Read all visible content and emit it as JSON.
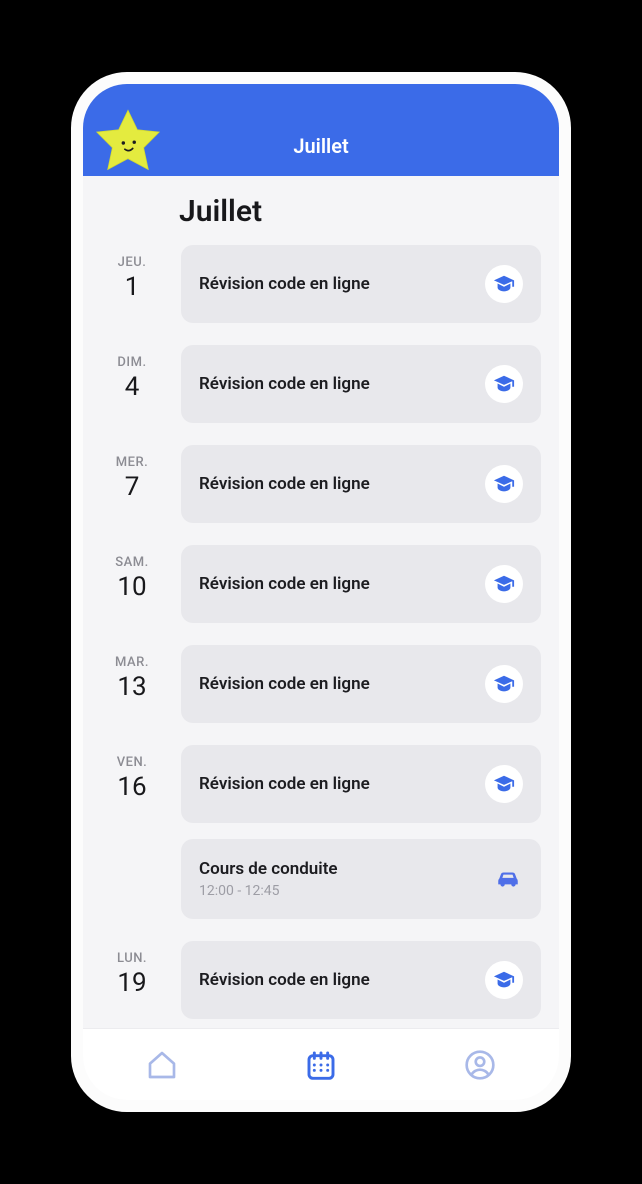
{
  "header": {
    "title": "Juillet"
  },
  "month_heading": "Juillet",
  "colors": {
    "accent": "#3B6BE8",
    "inactive": "#A8B8E8"
  },
  "tabbar": {
    "active_index": 1,
    "items": [
      "home",
      "calendar",
      "profile"
    ]
  },
  "days": [
    {
      "dow": "JEU.",
      "num": "1",
      "events": [
        {
          "title": "Révision code en ligne",
          "icon": "graduation"
        }
      ]
    },
    {
      "dow": "DIM.",
      "num": "4",
      "events": [
        {
          "title": "Révision code en ligne",
          "icon": "graduation"
        }
      ]
    },
    {
      "dow": "MER.",
      "num": "7",
      "events": [
        {
          "title": "Révision code en ligne",
          "icon": "graduation"
        }
      ]
    },
    {
      "dow": "SAM.",
      "num": "10",
      "events": [
        {
          "title": "Révision code en ligne",
          "icon": "graduation"
        }
      ]
    },
    {
      "dow": "MAR.",
      "num": "13",
      "events": [
        {
          "title": "Révision code en ligne",
          "icon": "graduation"
        }
      ]
    },
    {
      "dow": "VEN.",
      "num": "16",
      "events": [
        {
          "title": "Révision code en ligne",
          "icon": "graduation"
        },
        {
          "title": "Cours de conduite",
          "subtitle": "12:00 - 12:45",
          "icon": "car"
        }
      ]
    },
    {
      "dow": "LUN.",
      "num": "19",
      "events": [
        {
          "title": "Révision code en ligne",
          "icon": "graduation"
        }
      ]
    }
  ]
}
